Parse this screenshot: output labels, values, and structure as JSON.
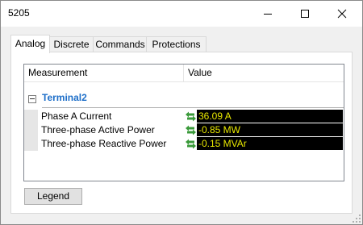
{
  "window": {
    "title": "5205"
  },
  "tabs": [
    {
      "label": "Analog",
      "active": true
    },
    {
      "label": "Discrete",
      "active": false
    },
    {
      "label": "Commands",
      "active": false
    },
    {
      "label": "Protections",
      "active": false
    }
  ],
  "grid": {
    "columns": [
      "Measurement",
      "Value"
    ],
    "group": {
      "label": "Terminal2",
      "expanded": true
    },
    "rows": [
      {
        "name": "Phase A Current",
        "value": "36.09 A",
        "icon": "sync-arrows-icon"
      },
      {
        "name": "Three-phase Active Power",
        "value": "-0.85 MW",
        "icon": "sync-arrows-icon"
      },
      {
        "name": "Three-phase Reactive Power",
        "value": "-0.15 MVAr",
        "icon": "sync-arrows-icon"
      }
    ]
  },
  "legend_button": "Legend",
  "colors": {
    "group_label": "#1e6fc9",
    "value_background": "#000000",
    "value_text": "#e8e800",
    "icon": "#3a9a3a"
  }
}
